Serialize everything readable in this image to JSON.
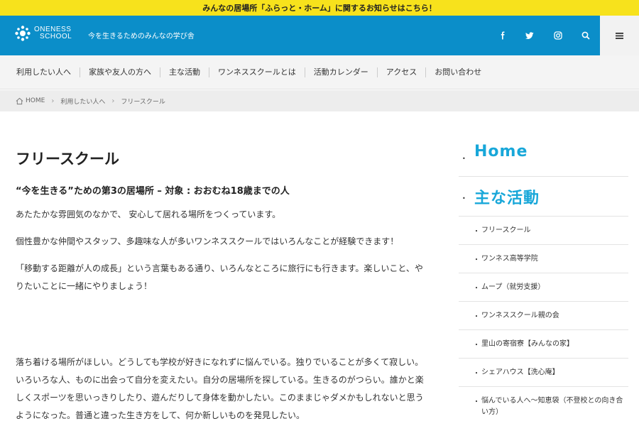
{
  "announcement": "みんなの居場所「ふらっと・ホーム」に関するお知らせはこちら！",
  "header": {
    "logo_line1": "ONENESS",
    "logo_line2": "SCHOOL",
    "tagline": "今を生きるためのみんなの学び舎",
    "social_icons": [
      "facebook-icon",
      "twitter-icon",
      "instagram-icon",
      "search-icon"
    ],
    "menu_icon": "hamburger-icon",
    "brand_color": "#0b8ec9",
    "banner_color": "#f7e21c"
  },
  "nav": {
    "items": [
      "利用したい人へ",
      "家族や友人の方へ",
      "主な活動",
      "ワンネススクールとは",
      "活動カレンダー",
      "アクセス",
      "お問い合わせ"
    ]
  },
  "breadcrumb": {
    "items": [
      "HOME",
      "利用したい人へ",
      "フリースクール"
    ]
  },
  "main": {
    "title": "フリースクール",
    "subtitle": "“今を生きる”ための第3の居場所 – 対象 : おおむね18歳までの人",
    "paragraphs": [
      "あたたかな雰囲気のなかで、 安心して居れる場所をつくっています。",
      "個性豊かな仲間やスタッフ、多趣味な人が多いワンネススクールではいろんなことが経験できます！",
      "「移動する距離が人の成長」という言葉もある通り、いろんなところに旅行にも行きます。楽しいこと、やりたいことに一緒にやりましょう！",
      "落ち着ける場所がほしい。どうしても学校が好きになれずに悩んでいる。独りでいることが多くて寂しい。いろいろな人、ものに出会って自分を変えたい。自分の居場所を探している。生きるのがつらい。誰かと楽しくスポーツを思いっきりしたり、遊んだりして身体を動かしたい。このままじゃダメかもしれないと思うようになった。普通と違った生き方をして、何か新しいものを発見したい。"
    ]
  },
  "sidebar": {
    "home_label": "Home",
    "activities_label": "主な活動",
    "accent_color": "#18a7d9",
    "items": [
      "フリースクール",
      "ワンネス高等学院",
      "ムープ（就労支援）",
      "ワンネススクール親の会",
      "里山の寄宿寮【みんなの家】",
      "シェアハウス【洗心庵】",
      "悩んでいる人へ〜知恵袋（不登校との向き合い方）"
    ]
  }
}
